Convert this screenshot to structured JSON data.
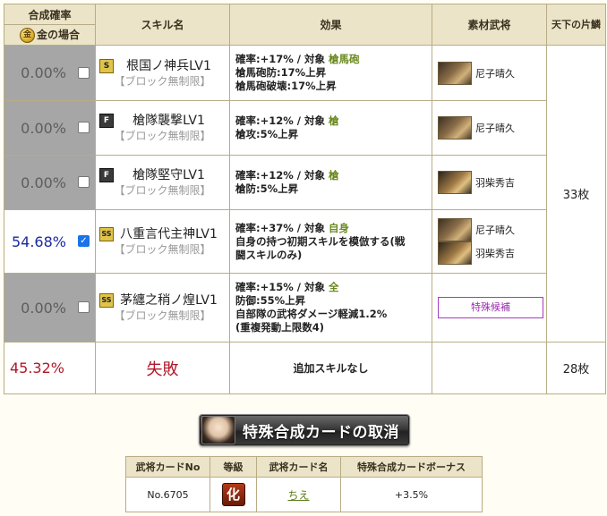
{
  "header": {
    "rate_title": "合成確率",
    "gold_label": "金の場合",
    "gold_icon_glyph": "金",
    "skill_name": "スキル名",
    "effect": "効果",
    "material": "素材武将",
    "tenka": "天下の片鱗"
  },
  "rows": [
    {
      "rate": "0.00%",
      "checked": false,
      "badge": "S",
      "skill": "根国ノ神兵LV1",
      "tag": "【ブロック無制限】",
      "effect_rate": "確率:+17% / 対象 ",
      "effect_target": "槍馬砲",
      "effect_lines": [
        "槍馬砲防:17%上昇",
        "槍馬砲破壊:17%上昇"
      ],
      "materials": [
        "尼子晴久"
      ]
    },
    {
      "rate": "0.00%",
      "checked": false,
      "badge": "F",
      "skill": "槍隊襲撃LV1",
      "tag": "【ブロック無制限】",
      "effect_rate": "確率:+12% / 対象 ",
      "effect_target": "槍",
      "effect_lines": [
        "槍攻:5%上昇"
      ],
      "materials": [
        "尼子晴久"
      ]
    },
    {
      "rate": "0.00%",
      "checked": false,
      "badge": "F",
      "skill": "槍隊堅守LV1",
      "tag": "【ブロック無制限】",
      "effect_rate": "確率:+12% / 対象 ",
      "effect_target": "槍",
      "effect_lines": [
        "槍防:5%上昇"
      ],
      "materials": [
        "羽柴秀吉"
      ]
    },
    {
      "rate": "54.68%",
      "checked": true,
      "badge": "SS",
      "skill": "八重言代主神LV1",
      "tag": "【ブロック無制限】",
      "effect_rate": "確率:+37% / 対象 ",
      "effect_target": "自身",
      "effect_lines": [
        "自身の持つ初期スキルを模倣する(戦",
        "闘スキルのみ)"
      ],
      "materials": [
        "尼子晴久",
        "羽柴秀吉"
      ]
    },
    {
      "rate": "0.00%",
      "checked": false,
      "badge": "SS",
      "skill": "茅纏之稍ノ煌LV1",
      "tag": "【ブロック無制限】",
      "effect_rate": "確率:+15% / 対象 ",
      "effect_target": "全",
      "effect_lines": [
        "防御:55%上昇",
        "自部隊の武将ダメージ軽減1.2%",
        "(重複発動上限数4)"
      ],
      "special": "特殊候補"
    }
  ],
  "tenka_count_1": "33枚",
  "fail": {
    "rate": "45.32%",
    "label": "失敗",
    "effect": "追加スキルなし",
    "count": "28枚"
  },
  "cancel_button": "特殊合成カードの取消",
  "card_table": {
    "headers": [
      "武将カードNo",
      "等級",
      "武将カード名",
      "特殊合成カードボーナス"
    ],
    "no": "No.6705",
    "rank": "化",
    "name": "ちえ",
    "bonus": "+3.5%"
  }
}
